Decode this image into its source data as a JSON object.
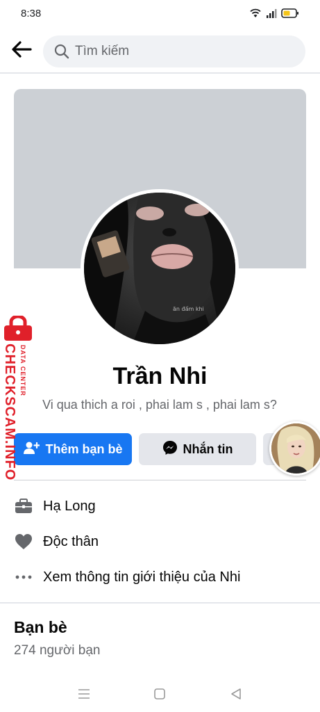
{
  "status_bar": {
    "time": "8:38",
    "icons": [
      "wifi-icon",
      "signal-icon",
      "battery-icon"
    ],
    "battery_color": "#f5c518"
  },
  "top_bar": {
    "back_icon": "arrow-left-icon",
    "search_placeholder": "Tìm kiếm",
    "search_icon": "search-icon"
  },
  "profile": {
    "cover_color": "#ccd0d5",
    "name": "Trần Nhi",
    "bio": "Vi qua thich a roi , phai lam s , phai lam s?",
    "avatar_caption": "ăn đấm khi"
  },
  "actions": {
    "add_friend_label": "Thêm bạn bè",
    "message_label": "Nhắn tin",
    "add_friend_icon": "person-add-icon",
    "message_icon": "messenger-icon",
    "primary_color": "#1877f2"
  },
  "intro": {
    "items": [
      {
        "icon": "briefcase-icon",
        "label": "Hạ Long"
      },
      {
        "icon": "heart-icon",
        "label": "Độc thân"
      },
      {
        "icon": "more-dots-icon",
        "label": "Xem thông tin giới thiệu của Nhi"
      }
    ]
  },
  "friends": {
    "title": "Bạn bè",
    "count_text": "274 người bạn"
  },
  "watermark": {
    "site": "CHECKSCAM.INFO",
    "tagline": "DATA CENTER",
    "color": "#e0202a"
  },
  "nav_bar": {
    "icons": [
      "menu-icon",
      "home-square-icon",
      "back-triangle-icon"
    ]
  }
}
